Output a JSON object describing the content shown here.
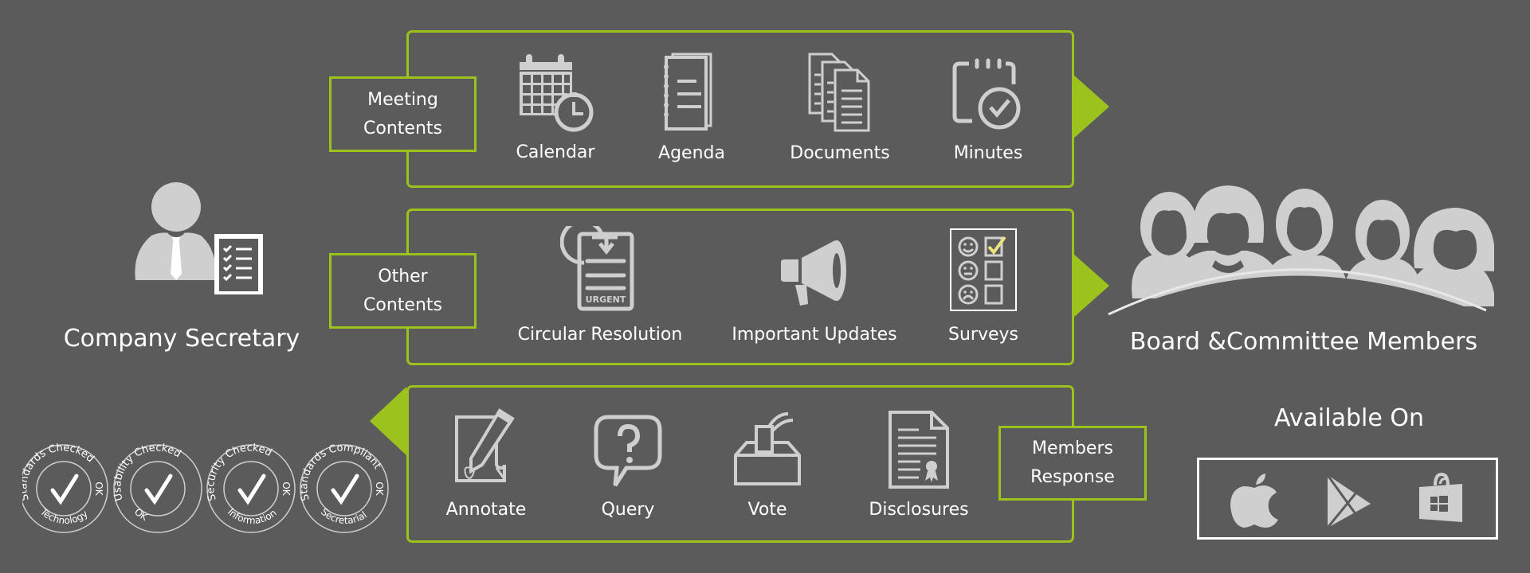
{
  "colors": {
    "background": "#5b5b5b",
    "accent_green": "#9cc31d",
    "icon_gray": "#cfcfcf",
    "text": "#ffffff"
  },
  "secretary": {
    "icon": "person-with-checklist-icon",
    "label": "Company Secretary"
  },
  "members": {
    "icon": "board-members-group-icon",
    "label": "Board &Committee Members"
  },
  "meeting_contents": {
    "tag_lines": [
      "Meeting",
      "Contents"
    ],
    "items": [
      {
        "label": "Calendar",
        "icon": "calendar-clock-icon"
      },
      {
        "label": "Agenda",
        "icon": "notebook-icon"
      },
      {
        "label": "Documents",
        "icon": "documents-stack-icon"
      },
      {
        "label": "Minutes",
        "icon": "clipboard-check-icon"
      }
    ]
  },
  "other_contents": {
    "tag_lines": [
      "Other",
      "Contents"
    ],
    "items": [
      {
        "label": "Circular Resolution",
        "icon": "urgent-document-icon",
        "icon_text": "URGENT"
      },
      {
        "label": "Important Updates",
        "icon": "megaphone-icon"
      },
      {
        "label": "Surveys",
        "icon": "survey-smileys-icon"
      }
    ]
  },
  "members_response": {
    "tag_lines": [
      "Members",
      "Response"
    ],
    "items": [
      {
        "label": "Annotate",
        "icon": "pencil-paper-icon"
      },
      {
        "label": "Query",
        "icon": "question-bubble-icon"
      },
      {
        "label": "Vote",
        "icon": "ballot-box-icon"
      },
      {
        "label": "Disclosures",
        "icon": "certificate-document-icon"
      }
    ]
  },
  "badges": [
    {
      "top": "Standards Checked",
      "bottom": "Technology",
      "side": "OK",
      "icon": "checkmark-seal-icon"
    },
    {
      "top": "Usability Checked",
      "bottom": "OK",
      "side": "",
      "icon": "checkmark-seal-icon"
    },
    {
      "top": "Security Checked",
      "bottom": "Information",
      "side": "OK",
      "icon": "checkmark-seal-icon"
    },
    {
      "top": "Standards Compliant",
      "bottom": "Secretarial",
      "side": "OK",
      "icon": "checkmark-seal-icon"
    }
  ],
  "available": {
    "title": "Available On",
    "stores": [
      {
        "name": "apple-icon"
      },
      {
        "name": "google-play-icon"
      },
      {
        "name": "windows-store-icon"
      }
    ]
  }
}
